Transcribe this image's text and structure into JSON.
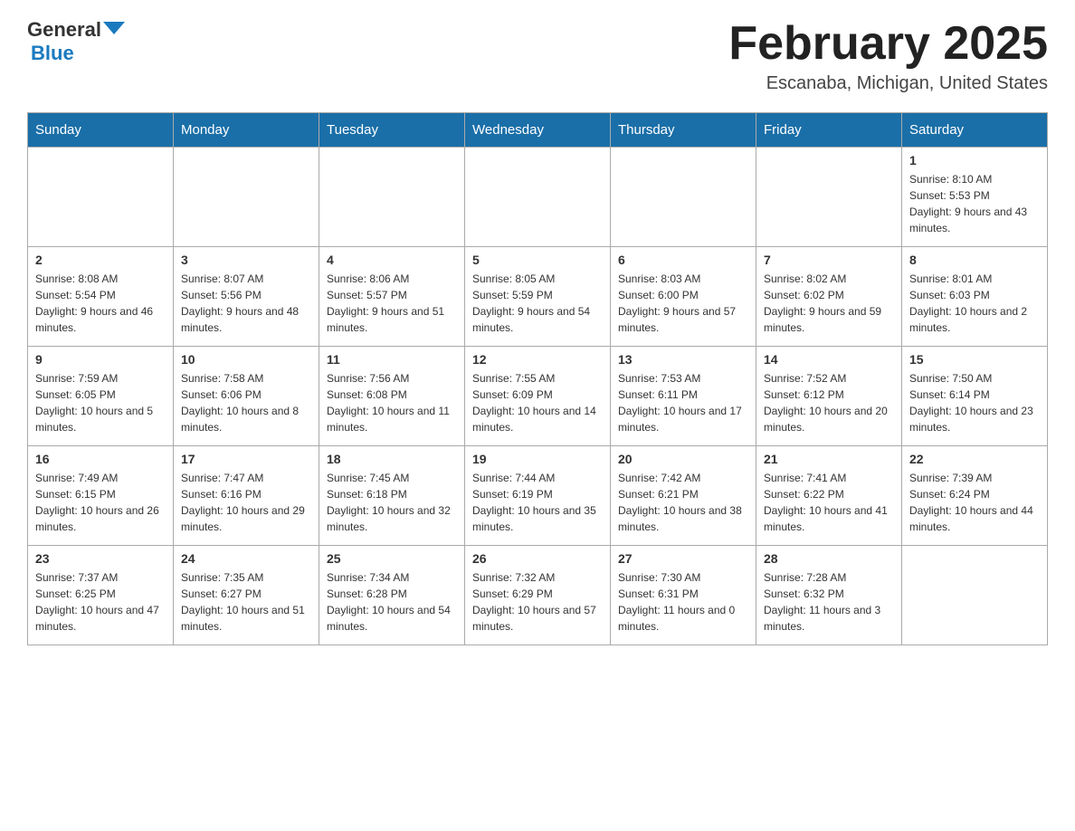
{
  "header": {
    "logo_general": "General",
    "logo_blue": "Blue",
    "month_title": "February 2025",
    "location": "Escanaba, Michigan, United States"
  },
  "days_of_week": [
    "Sunday",
    "Monday",
    "Tuesday",
    "Wednesday",
    "Thursday",
    "Friday",
    "Saturday"
  ],
  "weeks": [
    [
      {
        "day": "",
        "info": ""
      },
      {
        "day": "",
        "info": ""
      },
      {
        "day": "",
        "info": ""
      },
      {
        "day": "",
        "info": ""
      },
      {
        "day": "",
        "info": ""
      },
      {
        "day": "",
        "info": ""
      },
      {
        "day": "1",
        "info": "Sunrise: 8:10 AM\nSunset: 5:53 PM\nDaylight: 9 hours and 43 minutes."
      }
    ],
    [
      {
        "day": "2",
        "info": "Sunrise: 8:08 AM\nSunset: 5:54 PM\nDaylight: 9 hours and 46 minutes."
      },
      {
        "day": "3",
        "info": "Sunrise: 8:07 AM\nSunset: 5:56 PM\nDaylight: 9 hours and 48 minutes."
      },
      {
        "day": "4",
        "info": "Sunrise: 8:06 AM\nSunset: 5:57 PM\nDaylight: 9 hours and 51 minutes."
      },
      {
        "day": "5",
        "info": "Sunrise: 8:05 AM\nSunset: 5:59 PM\nDaylight: 9 hours and 54 minutes."
      },
      {
        "day": "6",
        "info": "Sunrise: 8:03 AM\nSunset: 6:00 PM\nDaylight: 9 hours and 57 minutes."
      },
      {
        "day": "7",
        "info": "Sunrise: 8:02 AM\nSunset: 6:02 PM\nDaylight: 9 hours and 59 minutes."
      },
      {
        "day": "8",
        "info": "Sunrise: 8:01 AM\nSunset: 6:03 PM\nDaylight: 10 hours and 2 minutes."
      }
    ],
    [
      {
        "day": "9",
        "info": "Sunrise: 7:59 AM\nSunset: 6:05 PM\nDaylight: 10 hours and 5 minutes."
      },
      {
        "day": "10",
        "info": "Sunrise: 7:58 AM\nSunset: 6:06 PM\nDaylight: 10 hours and 8 minutes."
      },
      {
        "day": "11",
        "info": "Sunrise: 7:56 AM\nSunset: 6:08 PM\nDaylight: 10 hours and 11 minutes."
      },
      {
        "day": "12",
        "info": "Sunrise: 7:55 AM\nSunset: 6:09 PM\nDaylight: 10 hours and 14 minutes."
      },
      {
        "day": "13",
        "info": "Sunrise: 7:53 AM\nSunset: 6:11 PM\nDaylight: 10 hours and 17 minutes."
      },
      {
        "day": "14",
        "info": "Sunrise: 7:52 AM\nSunset: 6:12 PM\nDaylight: 10 hours and 20 minutes."
      },
      {
        "day": "15",
        "info": "Sunrise: 7:50 AM\nSunset: 6:14 PM\nDaylight: 10 hours and 23 minutes."
      }
    ],
    [
      {
        "day": "16",
        "info": "Sunrise: 7:49 AM\nSunset: 6:15 PM\nDaylight: 10 hours and 26 minutes."
      },
      {
        "day": "17",
        "info": "Sunrise: 7:47 AM\nSunset: 6:16 PM\nDaylight: 10 hours and 29 minutes."
      },
      {
        "day": "18",
        "info": "Sunrise: 7:45 AM\nSunset: 6:18 PM\nDaylight: 10 hours and 32 minutes."
      },
      {
        "day": "19",
        "info": "Sunrise: 7:44 AM\nSunset: 6:19 PM\nDaylight: 10 hours and 35 minutes."
      },
      {
        "day": "20",
        "info": "Sunrise: 7:42 AM\nSunset: 6:21 PM\nDaylight: 10 hours and 38 minutes."
      },
      {
        "day": "21",
        "info": "Sunrise: 7:41 AM\nSunset: 6:22 PM\nDaylight: 10 hours and 41 minutes."
      },
      {
        "day": "22",
        "info": "Sunrise: 7:39 AM\nSunset: 6:24 PM\nDaylight: 10 hours and 44 minutes."
      }
    ],
    [
      {
        "day": "23",
        "info": "Sunrise: 7:37 AM\nSunset: 6:25 PM\nDaylight: 10 hours and 47 minutes."
      },
      {
        "day": "24",
        "info": "Sunrise: 7:35 AM\nSunset: 6:27 PM\nDaylight: 10 hours and 51 minutes."
      },
      {
        "day": "25",
        "info": "Sunrise: 7:34 AM\nSunset: 6:28 PM\nDaylight: 10 hours and 54 minutes."
      },
      {
        "day": "26",
        "info": "Sunrise: 7:32 AM\nSunset: 6:29 PM\nDaylight: 10 hours and 57 minutes."
      },
      {
        "day": "27",
        "info": "Sunrise: 7:30 AM\nSunset: 6:31 PM\nDaylight: 11 hours and 0 minutes."
      },
      {
        "day": "28",
        "info": "Sunrise: 7:28 AM\nSunset: 6:32 PM\nDaylight: 11 hours and 3 minutes."
      },
      {
        "day": "",
        "info": ""
      }
    ]
  ]
}
